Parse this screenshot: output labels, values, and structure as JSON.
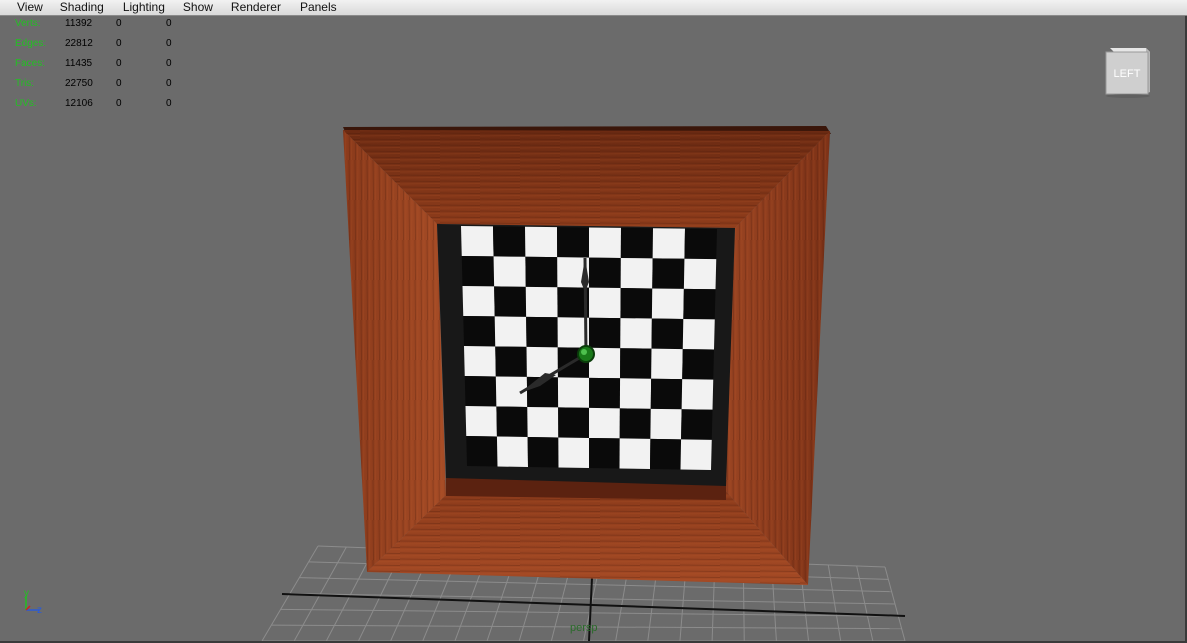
{
  "menu": {
    "items": [
      {
        "id": "view",
        "label": "View"
      },
      {
        "id": "shading",
        "label": "Shading"
      },
      {
        "id": "lighting",
        "label": "Lighting"
      },
      {
        "id": "show",
        "label": "Show"
      },
      {
        "id": "renderer",
        "label": "Renderer"
      },
      {
        "id": "panels",
        "label": "Panels"
      }
    ]
  },
  "hud": {
    "rows": [
      {
        "label": "Verts:",
        "total": "11392",
        "sel1": "0",
        "sel2": "0"
      },
      {
        "label": "Edges:",
        "total": "22812",
        "sel1": "0",
        "sel2": "0"
      },
      {
        "label": "Faces:",
        "total": "11435",
        "sel1": "0",
        "sel2": "0"
      },
      {
        "label": "Tris:",
        "total": "22750",
        "sel1": "0",
        "sel2": "0"
      },
      {
        "label": "UVs:",
        "total": "12106",
        "sel1": "0",
        "sel2": "0"
      }
    ]
  },
  "viewcube": {
    "face_label": "LEFT"
  },
  "axis_indicator": {
    "y_label": "y",
    "z_label": "z"
  },
  "camera": {
    "label": "persp"
  },
  "colors": {
    "background": "#6b6b6b",
    "wood_dark": "#5e2410",
    "wood_mid": "#8a3a1c",
    "wood_light": "#a54a26",
    "checker_black": "#0a0a0a",
    "checker_white": "#f2f2f2",
    "hud_label": "#22c022",
    "pivot": "#1a7a1a"
  },
  "icons": [
    "viewcube-icon",
    "axis-indicator-icon",
    "pivot-icon"
  ]
}
